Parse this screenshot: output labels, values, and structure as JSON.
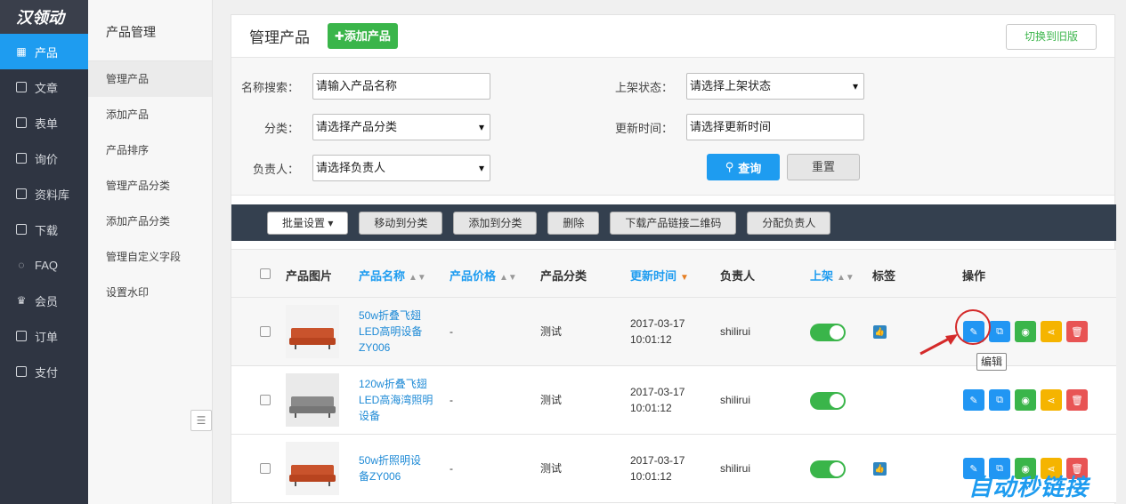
{
  "nav": {
    "logo": "汉领动",
    "toggle": "|||",
    "items": [
      {
        "label": "产品",
        "icon": "grid-icon",
        "active": true
      },
      {
        "label": "文章",
        "icon": "article-icon"
      },
      {
        "label": "表单",
        "icon": "clipboard-icon"
      },
      {
        "label": "询价",
        "icon": "inquiry-icon"
      },
      {
        "label": "资料库",
        "icon": "database-icon"
      },
      {
        "label": "下载",
        "icon": "download-icon"
      },
      {
        "label": "FAQ",
        "icon": "chat-icon"
      },
      {
        "label": "会员",
        "icon": "crown-icon"
      },
      {
        "label": "订单",
        "icon": "order-icon"
      },
      {
        "label": "支付",
        "icon": "payment-icon"
      }
    ]
  },
  "subnav": {
    "title": "产品管理",
    "items": [
      "管理产品",
      "添加产品",
      "产品排序",
      "管理产品分类",
      "添加产品分类",
      "管理自定义字段",
      "设置水印"
    ]
  },
  "header": {
    "title": "管理产品",
    "add_button": "添加产品",
    "switch_button": "切换到旧版"
  },
  "filters": {
    "name_label": "名称搜索：",
    "name_placeholder": "请输入产品名称",
    "category_label": "分类：",
    "category_value": "请选择产品分类",
    "owner_label": "负责人：",
    "owner_value": "请选择负责人",
    "status_label": "上架状态：",
    "status_value": "请选择上架状态",
    "updated_label": "更新时间：",
    "updated_placeholder": "请选择更新时间",
    "query_button": "查询",
    "reset_button": "重置"
  },
  "batch": {
    "buttons": [
      "批量设置 ▾",
      "移动到分类",
      "添加到分类",
      "删除",
      "下载产品链接二维码",
      "分配负责人"
    ]
  },
  "table": {
    "headers": {
      "image": "产品图片",
      "name": "产品名称",
      "price": "产品价格",
      "category": "产品分类",
      "updated": "更新时间",
      "owner": "负责人",
      "status": "上架",
      "tags": "标签",
      "actions": "操作"
    },
    "rows": [
      {
        "name_lines": [
          "50w折叠飞翅",
          "LED高明设备",
          "ZY006"
        ],
        "price": "-",
        "category": "测试",
        "date": "2017-03-17",
        "time": "10:01:12",
        "owner": "shilirui",
        "on": true,
        "has_tag": true,
        "sofa": "orange"
      },
      {
        "name_lines": [
          "120w折叠飞翅",
          "LED高海湾照明",
          "设备"
        ],
        "price": "-",
        "category": "测试",
        "date": "2017-03-17",
        "time": "10:01:12",
        "owner": "shilirui",
        "on": true,
        "has_tag": false,
        "sofa": "grey"
      },
      {
        "name_lines": [
          "50w折照明设",
          "备ZY006"
        ],
        "price": "-",
        "category": "测试",
        "date": "2017-03-17",
        "time": "10:01:12",
        "owner": "shilirui",
        "on": true,
        "has_tag": true,
        "sofa": "orange"
      }
    ]
  },
  "tooltip": "编辑",
  "watermark": "自动秒链接",
  "colors": {
    "accent": "#1e9cf0",
    "green": "#3ab54a",
    "orange_sofa": "#c9532c",
    "grey_sofa": "#8a8a8a"
  }
}
